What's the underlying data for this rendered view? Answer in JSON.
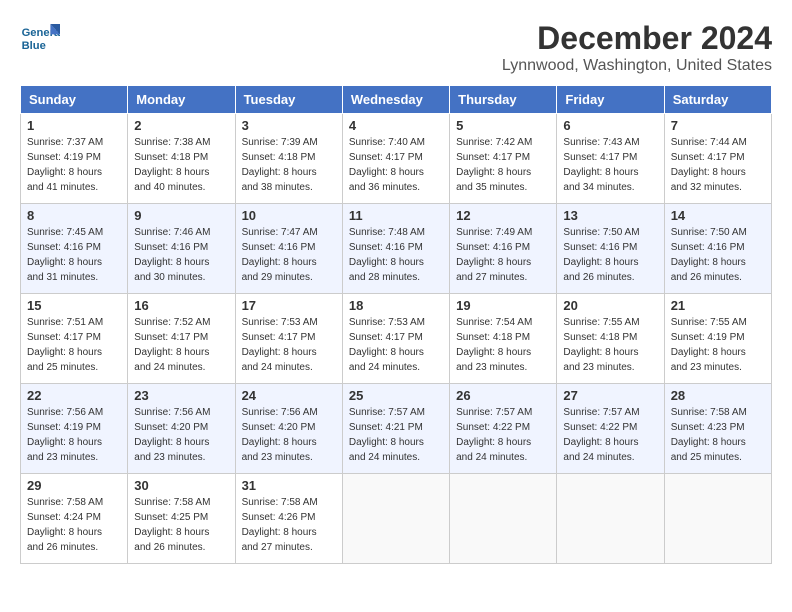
{
  "header": {
    "logo_line1": "General",
    "logo_line2": "Blue",
    "month_year": "December 2024",
    "location": "Lynnwood, Washington, United States"
  },
  "weekdays": [
    "Sunday",
    "Monday",
    "Tuesday",
    "Wednesday",
    "Thursday",
    "Friday",
    "Saturday"
  ],
  "weeks": [
    [
      {
        "day": "1",
        "sunrise": "7:37 AM",
        "sunset": "4:19 PM",
        "daylight": "8 hours and 41 minutes."
      },
      {
        "day": "2",
        "sunrise": "7:38 AM",
        "sunset": "4:18 PM",
        "daylight": "8 hours and 40 minutes."
      },
      {
        "day": "3",
        "sunrise": "7:39 AM",
        "sunset": "4:18 PM",
        "daylight": "8 hours and 38 minutes."
      },
      {
        "day": "4",
        "sunrise": "7:40 AM",
        "sunset": "4:17 PM",
        "daylight": "8 hours and 36 minutes."
      },
      {
        "day": "5",
        "sunrise": "7:42 AM",
        "sunset": "4:17 PM",
        "daylight": "8 hours and 35 minutes."
      },
      {
        "day": "6",
        "sunrise": "7:43 AM",
        "sunset": "4:17 PM",
        "daylight": "8 hours and 34 minutes."
      },
      {
        "day": "7",
        "sunrise": "7:44 AM",
        "sunset": "4:17 PM",
        "daylight": "8 hours and 32 minutes."
      }
    ],
    [
      {
        "day": "8",
        "sunrise": "7:45 AM",
        "sunset": "4:16 PM",
        "daylight": "8 hours and 31 minutes."
      },
      {
        "day": "9",
        "sunrise": "7:46 AM",
        "sunset": "4:16 PM",
        "daylight": "8 hours and 30 minutes."
      },
      {
        "day": "10",
        "sunrise": "7:47 AM",
        "sunset": "4:16 PM",
        "daylight": "8 hours and 29 minutes."
      },
      {
        "day": "11",
        "sunrise": "7:48 AM",
        "sunset": "4:16 PM",
        "daylight": "8 hours and 28 minutes."
      },
      {
        "day": "12",
        "sunrise": "7:49 AM",
        "sunset": "4:16 PM",
        "daylight": "8 hours and 27 minutes."
      },
      {
        "day": "13",
        "sunrise": "7:50 AM",
        "sunset": "4:16 PM",
        "daylight": "8 hours and 26 minutes."
      },
      {
        "day": "14",
        "sunrise": "7:50 AM",
        "sunset": "4:16 PM",
        "daylight": "8 hours and 26 minutes."
      }
    ],
    [
      {
        "day": "15",
        "sunrise": "7:51 AM",
        "sunset": "4:17 PM",
        "daylight": "8 hours and 25 minutes."
      },
      {
        "day": "16",
        "sunrise": "7:52 AM",
        "sunset": "4:17 PM",
        "daylight": "8 hours and 24 minutes."
      },
      {
        "day": "17",
        "sunrise": "7:53 AM",
        "sunset": "4:17 PM",
        "daylight": "8 hours and 24 minutes."
      },
      {
        "day": "18",
        "sunrise": "7:53 AM",
        "sunset": "4:17 PM",
        "daylight": "8 hours and 24 minutes."
      },
      {
        "day": "19",
        "sunrise": "7:54 AM",
        "sunset": "4:18 PM",
        "daylight": "8 hours and 23 minutes."
      },
      {
        "day": "20",
        "sunrise": "7:55 AM",
        "sunset": "4:18 PM",
        "daylight": "8 hours and 23 minutes."
      },
      {
        "day": "21",
        "sunrise": "7:55 AM",
        "sunset": "4:19 PM",
        "daylight": "8 hours and 23 minutes."
      }
    ],
    [
      {
        "day": "22",
        "sunrise": "7:56 AM",
        "sunset": "4:19 PM",
        "daylight": "8 hours and 23 minutes."
      },
      {
        "day": "23",
        "sunrise": "7:56 AM",
        "sunset": "4:20 PM",
        "daylight": "8 hours and 23 minutes."
      },
      {
        "day": "24",
        "sunrise": "7:56 AM",
        "sunset": "4:20 PM",
        "daylight": "8 hours and 23 minutes."
      },
      {
        "day": "25",
        "sunrise": "7:57 AM",
        "sunset": "4:21 PM",
        "daylight": "8 hours and 24 minutes."
      },
      {
        "day": "26",
        "sunrise": "7:57 AM",
        "sunset": "4:22 PM",
        "daylight": "8 hours and 24 minutes."
      },
      {
        "day": "27",
        "sunrise": "7:57 AM",
        "sunset": "4:22 PM",
        "daylight": "8 hours and 24 minutes."
      },
      {
        "day": "28",
        "sunrise": "7:58 AM",
        "sunset": "4:23 PM",
        "daylight": "8 hours and 25 minutes."
      }
    ],
    [
      {
        "day": "29",
        "sunrise": "7:58 AM",
        "sunset": "4:24 PM",
        "daylight": "8 hours and 26 minutes."
      },
      {
        "day": "30",
        "sunrise": "7:58 AM",
        "sunset": "4:25 PM",
        "daylight": "8 hours and 26 minutes."
      },
      {
        "day": "31",
        "sunrise": "7:58 AM",
        "sunset": "4:26 PM",
        "daylight": "8 hours and 27 minutes."
      },
      null,
      null,
      null,
      null
    ]
  ]
}
